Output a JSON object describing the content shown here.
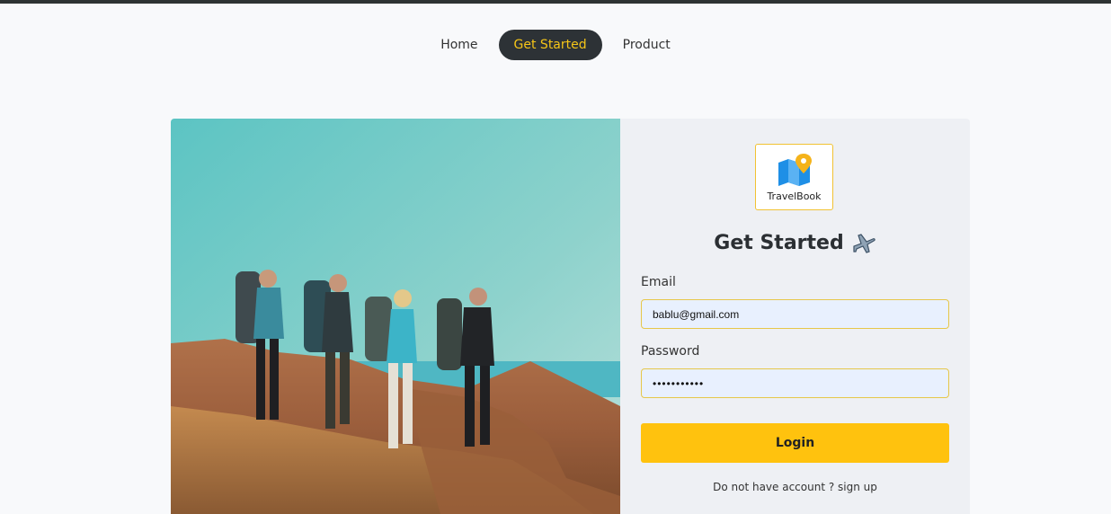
{
  "nav": {
    "items": [
      {
        "label": "Home",
        "active": false
      },
      {
        "label": "Get Started",
        "active": true
      },
      {
        "label": "Product",
        "active": false
      }
    ]
  },
  "logo": {
    "text": "TravelBook",
    "icon": "folded-map-pin-icon"
  },
  "form": {
    "title": "Get Started",
    "title_icon": "airplane-icon",
    "email_label": "Email",
    "email_value": "bablu@gmail.com",
    "password_label": "Password",
    "password_value": "•••••••••••",
    "login_label": "Login",
    "signup_text": "Do not have account ? sign up"
  },
  "colors": {
    "accent": "#ffc20e",
    "nav_active_bg": "#2d3236",
    "nav_active_text": "#f5c518",
    "field_bg": "#e8f0fe",
    "field_border": "#e6c74a"
  }
}
